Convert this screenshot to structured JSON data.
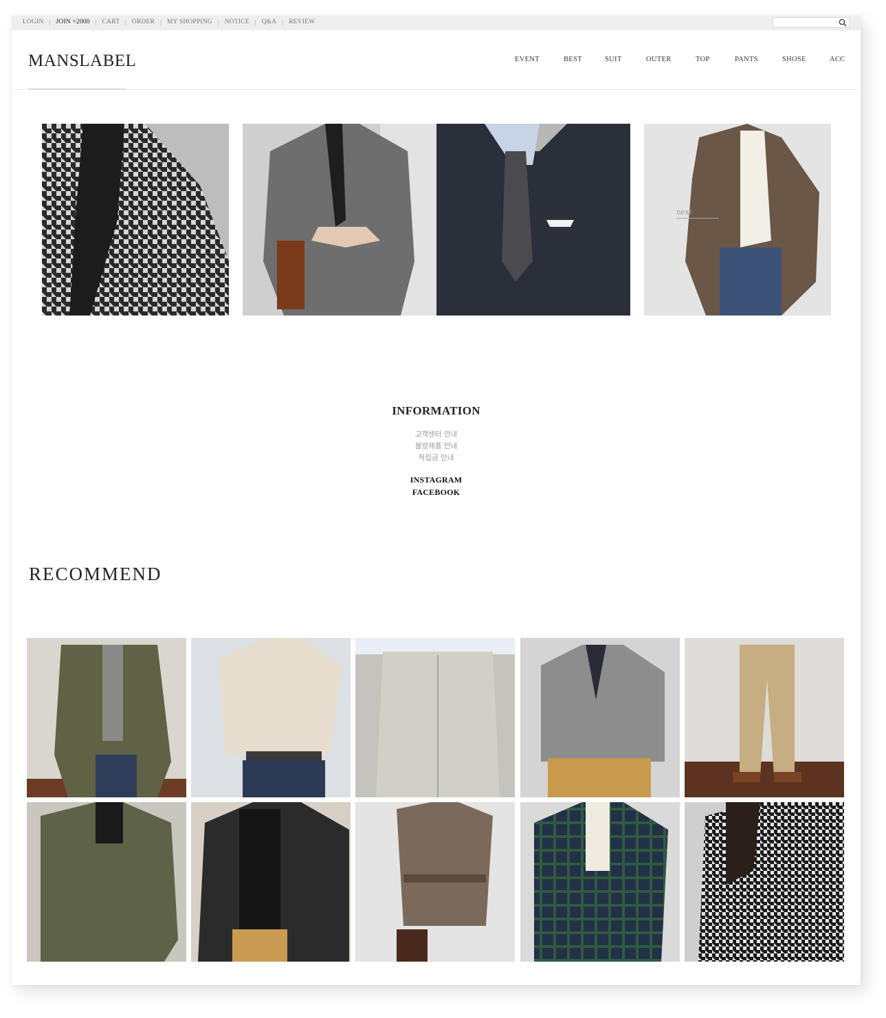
{
  "util_nav": {
    "login": "LOGIN",
    "join": "JOIN +2000",
    "cart": "CART",
    "order": "ORDER",
    "my_shopping": "MY SHOPPING",
    "notice": "NOTICE",
    "qa": "Q&A",
    "review": "REVIEW"
  },
  "search": {
    "placeholder": "",
    "icon": "search-icon"
  },
  "brand": {
    "logo": "MANSLABEL"
  },
  "main_nav": [
    "EVENT",
    "BEST",
    "SUIT",
    "OUTER",
    "TOP",
    "PANTS",
    "SHOSE",
    "ACC"
  ],
  "banner": {
    "next_label": "next"
  },
  "information": {
    "title": "INFORMATION",
    "links": [
      "고객센터 안내",
      "불량제품 안내",
      "적립금 안내"
    ],
    "social": [
      "INSTAGRAM",
      "FACEBOOK"
    ]
  },
  "recommend": {
    "title": "RECOMMEND"
  },
  "colors": {
    "topbar_bg": "#eeeeee",
    "logo_underline": "#b9c3cf",
    "text": "#222222"
  }
}
